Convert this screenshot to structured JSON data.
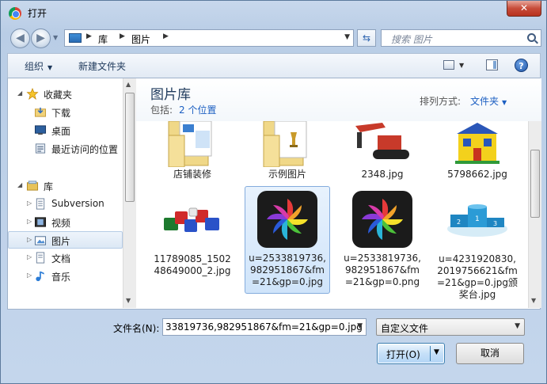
{
  "window": {
    "title": "打开",
    "close_label": "✕"
  },
  "address": {
    "crumbs": [
      "库",
      "图片"
    ]
  },
  "search": {
    "placeholder": "搜索 图片"
  },
  "toolbar": {
    "organize_label": "组织",
    "new_folder_label": "新建文件夹",
    "help_label": "?"
  },
  "nav": {
    "items": [
      {
        "label": "收藏夹",
        "icon": "star-icon"
      },
      {
        "label": "下载",
        "icon": "download-folder-icon"
      },
      {
        "label": "桌面",
        "icon": "desktop-icon"
      },
      {
        "label": "最近访问的位置",
        "icon": "recent-places-icon"
      },
      {
        "label": "库",
        "icon": "library-icon"
      },
      {
        "label": "Subversion",
        "icon": "document-library-icon"
      },
      {
        "label": "视频",
        "icon": "video-library-icon"
      },
      {
        "label": "图片",
        "icon": "picture-library-icon"
      },
      {
        "label": "文档",
        "icon": "document-library-icon"
      },
      {
        "label": "音乐",
        "icon": "music-library-icon"
      }
    ]
  },
  "library": {
    "title": "图片库",
    "includes_label": "包括:",
    "locations_label": "2 个位置",
    "sort_label": "排列方式:",
    "sort_value": "文件夹"
  },
  "files": [
    {
      "name": "店铺装修",
      "kind": "folder"
    },
    {
      "name": "示例图片",
      "kind": "folder"
    },
    {
      "name": "2348.jpg",
      "kind": "image"
    },
    {
      "name": "5798662.jpg",
      "kind": "image"
    },
    {
      "name": "11789085_150248649000_2.jpg",
      "kind": "image"
    },
    {
      "name": "u=2533819736,982951867&fm=21&gp=0.jpg",
      "kind": "image",
      "selected": true
    },
    {
      "name": "u=2533819736,982951867&fm=21&gp=0.png",
      "kind": "image"
    },
    {
      "name": "u=4231920830,2019756621&fm=21&gp=0.jpg颁奖台.jpg",
      "kind": "image"
    }
  ],
  "footer": {
    "filename_label": "文件名(N):",
    "filename_value": "33819736,982951867&fm=21&gp=0.jpg",
    "filetype_value": "自定义文件",
    "open_label": "打开(O)",
    "cancel_label": "取消"
  }
}
